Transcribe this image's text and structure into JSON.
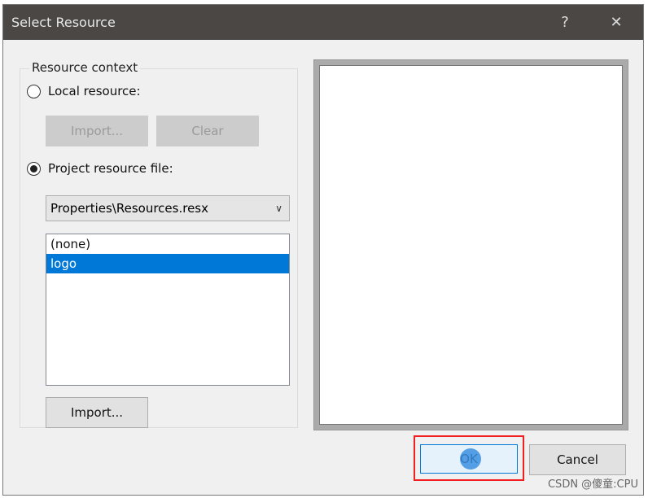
{
  "title": "Select Resource",
  "title_buttons": {
    "help": "?",
    "close": "✕"
  },
  "group": {
    "label": "Resource context",
    "local_radio": "Local resource:",
    "local_import": "Import...",
    "local_clear": "Clear",
    "project_radio": "Project resource file:",
    "resource_file": "Properties\\Resources.resx",
    "resources": [
      "(none)",
      "logo"
    ],
    "selected": "logo",
    "import": "Import..."
  },
  "buttons": {
    "ok": "OK",
    "cancel": "Cancel"
  },
  "watermark": "CSDN @傻童:CPU",
  "colors": {
    "titlebar": "#4a4745",
    "selection": "#0078d7",
    "highlight": "#f02020"
  }
}
